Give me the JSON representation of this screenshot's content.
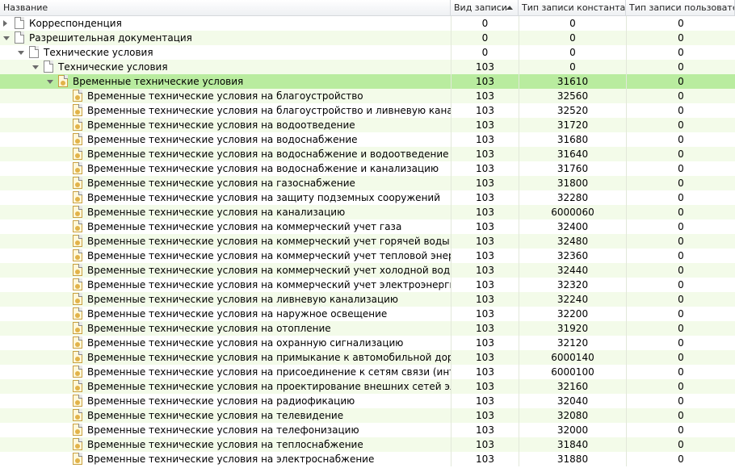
{
  "columns": {
    "name": "Название",
    "kind": "Вид записи",
    "type_const": "Тип записи константа",
    "type_user": "Тип записи пользователя"
  },
  "rows": [
    {
      "level": 0,
      "expander": "closed",
      "icon": "document-icon",
      "name": "Корреспонденция",
      "kind": "0",
      "type_const": "0",
      "type_user": "0"
    },
    {
      "level": 0,
      "expander": "open",
      "icon": "document-icon",
      "name": "Разрешительная документация",
      "kind": "0",
      "type_const": "0",
      "type_user": "0"
    },
    {
      "level": 1,
      "expander": "open",
      "icon": "document-icon",
      "name": "Технические условия",
      "kind": "0",
      "type_const": "0",
      "type_user": "0"
    },
    {
      "level": 2,
      "expander": "open",
      "icon": "document-icon",
      "name": "Технические условия",
      "kind": "103",
      "type_const": "0",
      "type_user": "0"
    },
    {
      "level": 3,
      "expander": "open",
      "icon": "certificate-icon",
      "name": "Временные технические условия",
      "kind": "103",
      "type_const": "31610",
      "type_user": "0",
      "selected": true
    },
    {
      "level": 4,
      "expander": "none",
      "icon": "certificate-icon",
      "name": "Временные технические условия на благоустройство",
      "kind": "103",
      "type_const": "32560",
      "type_user": "0"
    },
    {
      "level": 4,
      "expander": "none",
      "icon": "certificate-icon",
      "name": "Временные технические условия на благоустройство и ливневую канализац",
      "kind": "103",
      "type_const": "32520",
      "type_user": "0"
    },
    {
      "level": 4,
      "expander": "none",
      "icon": "certificate-icon",
      "name": "Временные технические условия на водоотведение",
      "kind": "103",
      "type_const": "31720",
      "type_user": "0"
    },
    {
      "level": 4,
      "expander": "none",
      "icon": "certificate-icon",
      "name": "Временные технические условия на водоснабжение",
      "kind": "103",
      "type_const": "31680",
      "type_user": "0"
    },
    {
      "level": 4,
      "expander": "none",
      "icon": "certificate-icon",
      "name": "Временные технические условия на водоснабжение и водоотведение",
      "kind": "103",
      "type_const": "31640",
      "type_user": "0"
    },
    {
      "level": 4,
      "expander": "none",
      "icon": "certificate-icon",
      "name": "Временные технические условия на водоснабжение и канализацию",
      "kind": "103",
      "type_const": "31760",
      "type_user": "0"
    },
    {
      "level": 4,
      "expander": "none",
      "icon": "certificate-icon",
      "name": "Временные технические условия на газоснабжение",
      "kind": "103",
      "type_const": "31800",
      "type_user": "0"
    },
    {
      "level": 4,
      "expander": "none",
      "icon": "certificate-icon",
      "name": "Временные технические условия на защиту подземных сооружений",
      "kind": "103",
      "type_const": "32280",
      "type_user": "0"
    },
    {
      "level": 4,
      "expander": "none",
      "icon": "certificate-icon",
      "name": "Временные технические условия на канализацию",
      "kind": "103",
      "type_const": "6000060",
      "type_user": "0"
    },
    {
      "level": 4,
      "expander": "none",
      "icon": "certificate-icon",
      "name": "Временные технические условия на коммерческий учет газа",
      "kind": "103",
      "type_const": "32400",
      "type_user": "0"
    },
    {
      "level": 4,
      "expander": "none",
      "icon": "certificate-icon",
      "name": "Временные технические условия на коммерческий учет горячей воды",
      "kind": "103",
      "type_const": "32480",
      "type_user": "0"
    },
    {
      "level": 4,
      "expander": "none",
      "icon": "certificate-icon",
      "name": "Временные технические условия на коммерческий учет тепловой энергии",
      "kind": "103",
      "type_const": "32360",
      "type_user": "0"
    },
    {
      "level": 4,
      "expander": "none",
      "icon": "certificate-icon",
      "name": "Временные технические условия на коммерческий учет холодной воды",
      "kind": "103",
      "type_const": "32440",
      "type_user": "0"
    },
    {
      "level": 4,
      "expander": "none",
      "icon": "certificate-icon",
      "name": "Временные технические условия на коммерческий учет электроэнергии",
      "kind": "103",
      "type_const": "32320",
      "type_user": "0"
    },
    {
      "level": 4,
      "expander": "none",
      "icon": "certificate-icon",
      "name": "Временные технические условия на ливневую канализацию",
      "kind": "103",
      "type_const": "32240",
      "type_user": "0"
    },
    {
      "level": 4,
      "expander": "none",
      "icon": "certificate-icon",
      "name": "Временные технические условия на наружное освещение",
      "kind": "103",
      "type_const": "32200",
      "type_user": "0"
    },
    {
      "level": 4,
      "expander": "none",
      "icon": "certificate-icon",
      "name": "Временные технические условия на отопление",
      "kind": "103",
      "type_const": "31920",
      "type_user": "0"
    },
    {
      "level": 4,
      "expander": "none",
      "icon": "certificate-icon",
      "name": "Временные технические условия на охранную сигнализацию",
      "kind": "103",
      "type_const": "32120",
      "type_user": "0"
    },
    {
      "level": 4,
      "expander": "none",
      "icon": "certificate-icon",
      "name": "Временные технические условия на примыкание к автомобильной дороге",
      "kind": "103",
      "type_const": "6000140",
      "type_user": "0"
    },
    {
      "level": 4,
      "expander": "none",
      "icon": "certificate-icon",
      "name": "Временные технические условия на присоединение к сетям связи (интерне",
      "kind": "103",
      "type_const": "6000100",
      "type_user": "0"
    },
    {
      "level": 4,
      "expander": "none",
      "icon": "certificate-icon",
      "name": "Временные технические условия на проектирование внешних сетей электр",
      "kind": "103",
      "type_const": "32160",
      "type_user": "0"
    },
    {
      "level": 4,
      "expander": "none",
      "icon": "certificate-icon",
      "name": "Временные технические условия на радиофикацию",
      "kind": "103",
      "type_const": "32040",
      "type_user": "0"
    },
    {
      "level": 4,
      "expander": "none",
      "icon": "certificate-icon",
      "name": "Временные технические условия на телевидение",
      "kind": "103",
      "type_const": "32080",
      "type_user": "0"
    },
    {
      "level": 4,
      "expander": "none",
      "icon": "certificate-icon",
      "name": "Временные технические условия на телефонизацию",
      "kind": "103",
      "type_const": "32000",
      "type_user": "0"
    },
    {
      "level": 4,
      "expander": "none",
      "icon": "certificate-icon",
      "name": "Временные технические условия на теплоснабжение",
      "kind": "103",
      "type_const": "31840",
      "type_user": "0"
    },
    {
      "level": 4,
      "expander": "none",
      "icon": "certificate-icon",
      "name": "Временные технические условия на электроснабжение",
      "kind": "103",
      "type_const": "31880",
      "type_user": "0"
    }
  ]
}
